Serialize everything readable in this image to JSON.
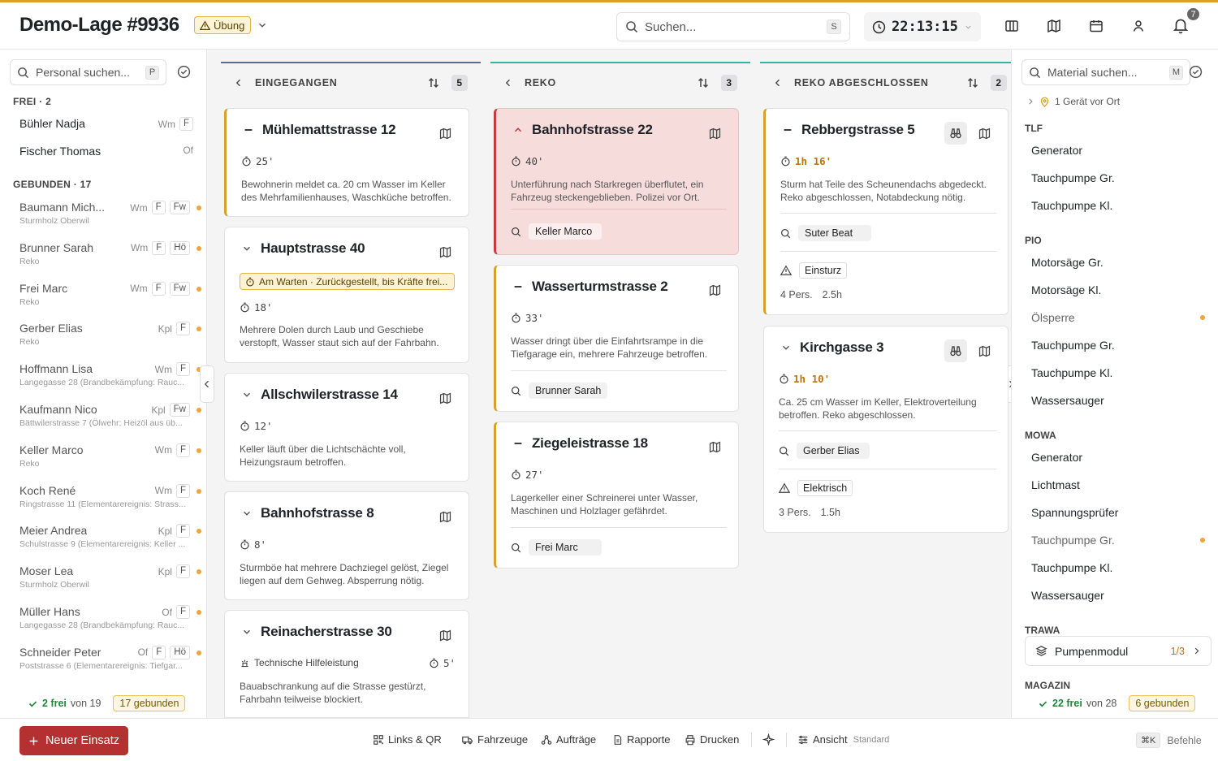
{
  "header": {
    "title": "Demo-Lage #9936",
    "mode_badge": "Übung",
    "search_placeholder": "Suchen...",
    "search_shortcut": "S",
    "clock": "22:13:15",
    "notification_count": "7"
  },
  "personnel": {
    "search_placeholder": "Personal suchen...",
    "search_shortcut": "P",
    "free_header": "FREI · 2",
    "free": [
      {
        "name": "Bühler Nadja",
        "rank": "Wm",
        "tags": [
          "F"
        ]
      },
      {
        "name": "Fischer Thomas",
        "rank": "Of",
        "tags": []
      }
    ],
    "bound_header": "GEBUNDEN · 17",
    "bound": [
      {
        "name": "Baumann Mich...",
        "rank": "Wm",
        "tags": [
          "F",
          "Fw"
        ],
        "sub": "Sturmholz Oberwil"
      },
      {
        "name": "Brunner Sarah",
        "rank": "Wm",
        "tags": [
          "F",
          "Hö"
        ],
        "sub": "Reko"
      },
      {
        "name": "Frei Marc",
        "rank": "Wm",
        "tags": [
          "F",
          "Fw"
        ],
        "sub": "Reko"
      },
      {
        "name": "Gerber Elias",
        "rank": "Kpl",
        "tags": [
          "F"
        ],
        "sub": "Reko"
      },
      {
        "name": "Hoffmann Lisa",
        "rank": "Wm",
        "tags": [
          "F"
        ],
        "sub": "Langegasse 28 (Brandbekämpfung: Rauc..."
      },
      {
        "name": "Kaufmann Nico",
        "rank": "Kpl",
        "tags": [
          "Fw"
        ],
        "sub": "Bättwilerstrasse 7 (Ölwehr: Heizöl aus üb..."
      },
      {
        "name": "Keller Marco",
        "rank": "Wm",
        "tags": [
          "F"
        ],
        "sub": "Reko"
      },
      {
        "name": "Koch René",
        "rank": "Wm",
        "tags": [
          "F"
        ],
        "sub": "Ringstrasse 11 (Elementarereignis: Strass..."
      },
      {
        "name": "Meier Andrea",
        "rank": "Kpl",
        "tags": [
          "F"
        ],
        "sub": "Schulstrasse 9 (Elementarereignis: Keller ..."
      },
      {
        "name": "Moser Lea",
        "rank": "Kpl",
        "tags": [
          "F"
        ],
        "sub": "Sturmholz Oberwil"
      },
      {
        "name": "Müller Hans",
        "rank": "Of",
        "tags": [
          "F"
        ],
        "sub": "Langegasse 28 (Brandbekämpfung: Rauc..."
      },
      {
        "name": "Schneider Peter",
        "rank": "Of",
        "tags": [
          "F",
          "Hö"
        ],
        "sub": "Poststrasse 6 (Elementarereignis: Tiefgar..."
      }
    ],
    "footer": {
      "free": "2 frei",
      "of": "von 19",
      "bound": "17 gebunden"
    }
  },
  "columns": [
    {
      "title": "EINGEGANGEN",
      "count": "5",
      "color": "#5b6b8c"
    },
    {
      "title": "REKO",
      "count": "3",
      "color": "#2bb7a0"
    },
    {
      "title": "REKO ABGESCHLOSSEN",
      "count": "2",
      "color": "#2bb7a0"
    }
  ],
  "cards_eingegangen": [
    {
      "title": "Mühlemattstrasse 12",
      "time": "25'",
      "desc": "Bewohnerin meldet ca. 20 cm Wasser im Keller des Mehrfamilienhauses, Waschküche betroffen."
    },
    {
      "title": "Hauptstrasse 40",
      "waiting": "Am Warten · Zurückgestellt, bis Kräfte frei...",
      "time": "18'",
      "desc": "Mehrere Dolen durch Laub und Geschiebe verstopft, Wasser staut sich auf der Fahrbahn."
    },
    {
      "title": "Allschwilerstrasse 14",
      "time": "12'",
      "desc": "Keller läuft über die Lichtschächte voll, Heizungsraum betroffen."
    },
    {
      "title": "Bahnhofstrasse 8",
      "time": "8'",
      "desc": "Sturmböe hat mehrere Dachziegel gelöst, Ziegel liegen auf dem Gehweg. Absperrung nötig."
    },
    {
      "title": "Reinacherstrasse 30",
      "type": "Technische Hilfeleistung",
      "time": "5'",
      "desc": "Bauabschrankung auf die Strasse gestürzt, Fahrbahn teilweise blockiert."
    }
  ],
  "cards_reko": [
    {
      "title": "Bahnhofstrasse 22",
      "time": "40'",
      "desc": "Unterführung nach Starkregen überflutet, ein Fahrzeug steckengeblieben. Polizei vor Ort.",
      "person": "Keller Marco"
    },
    {
      "title": "Wasserturmstrasse 2",
      "time": "33'",
      "desc": "Wasser dringt über die Einfahrtsrampe in die Tiefgarage ein, mehrere Fahrzeuge betroffen.",
      "person": "Brunner Sarah"
    },
    {
      "title": "Ziegeleistrasse 18",
      "time": "27'",
      "desc": "Lagerkeller einer Schreinerei unter Wasser, Maschinen und Holzlager gefährdet.",
      "person": "Frei Marc"
    }
  ],
  "cards_reko_done": [
    {
      "title": "Rebbergstrasse 5",
      "time": "1h 16'",
      "desc": "Sturm hat Teile des Scheunendachs abgedeckt. Reko abgeschlossen, Notabdeckung nötig.",
      "person": "Suter Beat",
      "hazard": "Einsturz",
      "pers": "4 Pers.",
      "dur": "2.5h"
    },
    {
      "title": "Kirchgasse 3",
      "time": "1h 10'",
      "desc": "Ca. 25 cm Wasser im Keller, Elektroverteilung betroffen. Reko abgeschlossen.",
      "person": "Gerber Elias",
      "hazard": "Elektrisch",
      "pers": "3 Pers.",
      "dur": "1.5h"
    }
  ],
  "material": {
    "search_placeholder": "Material suchen...",
    "search_shortcut": "M",
    "on_site": "1 Gerät vor Ort",
    "groups": [
      {
        "name": "TLF",
        "items": [
          "Generator",
          "Tauchpumpe Gr.",
          "Tauchpumpe Kl."
        ]
      },
      {
        "name": "PIO",
        "items": [
          "Motorsäge Gr.",
          "Motorsäge Kl.",
          "Ölsperre",
          "Tauchpumpe Gr.",
          "Tauchpumpe Kl.",
          "Wassersauger"
        ]
      },
      {
        "name": "MOWA",
        "items": [
          "Generator",
          "Lichtmast",
          "Spannungsprüfer",
          "Tauchpumpe Gr.",
          "Tauchpumpe Kl.",
          "Wassersauger"
        ]
      },
      {
        "name": "TRAWA",
        "items": []
      }
    ],
    "pump_module": {
      "label": "Pumpenmodul",
      "fraction": "1/3"
    },
    "next_group": "MAGAZIN",
    "footer": {
      "free": "22 frei",
      "of": "von 28",
      "bound": "6 gebunden"
    }
  },
  "bottom": {
    "new_button": "Neuer Einsatz",
    "links": "Links & QR",
    "vehicles": "Fahrzeuge",
    "orders": "Aufträge",
    "reports": "Rapporte",
    "print": "Drucken",
    "view": "Ansicht",
    "view_mode": "Standard",
    "commands_key": "⌘K",
    "commands": "Befehle"
  }
}
